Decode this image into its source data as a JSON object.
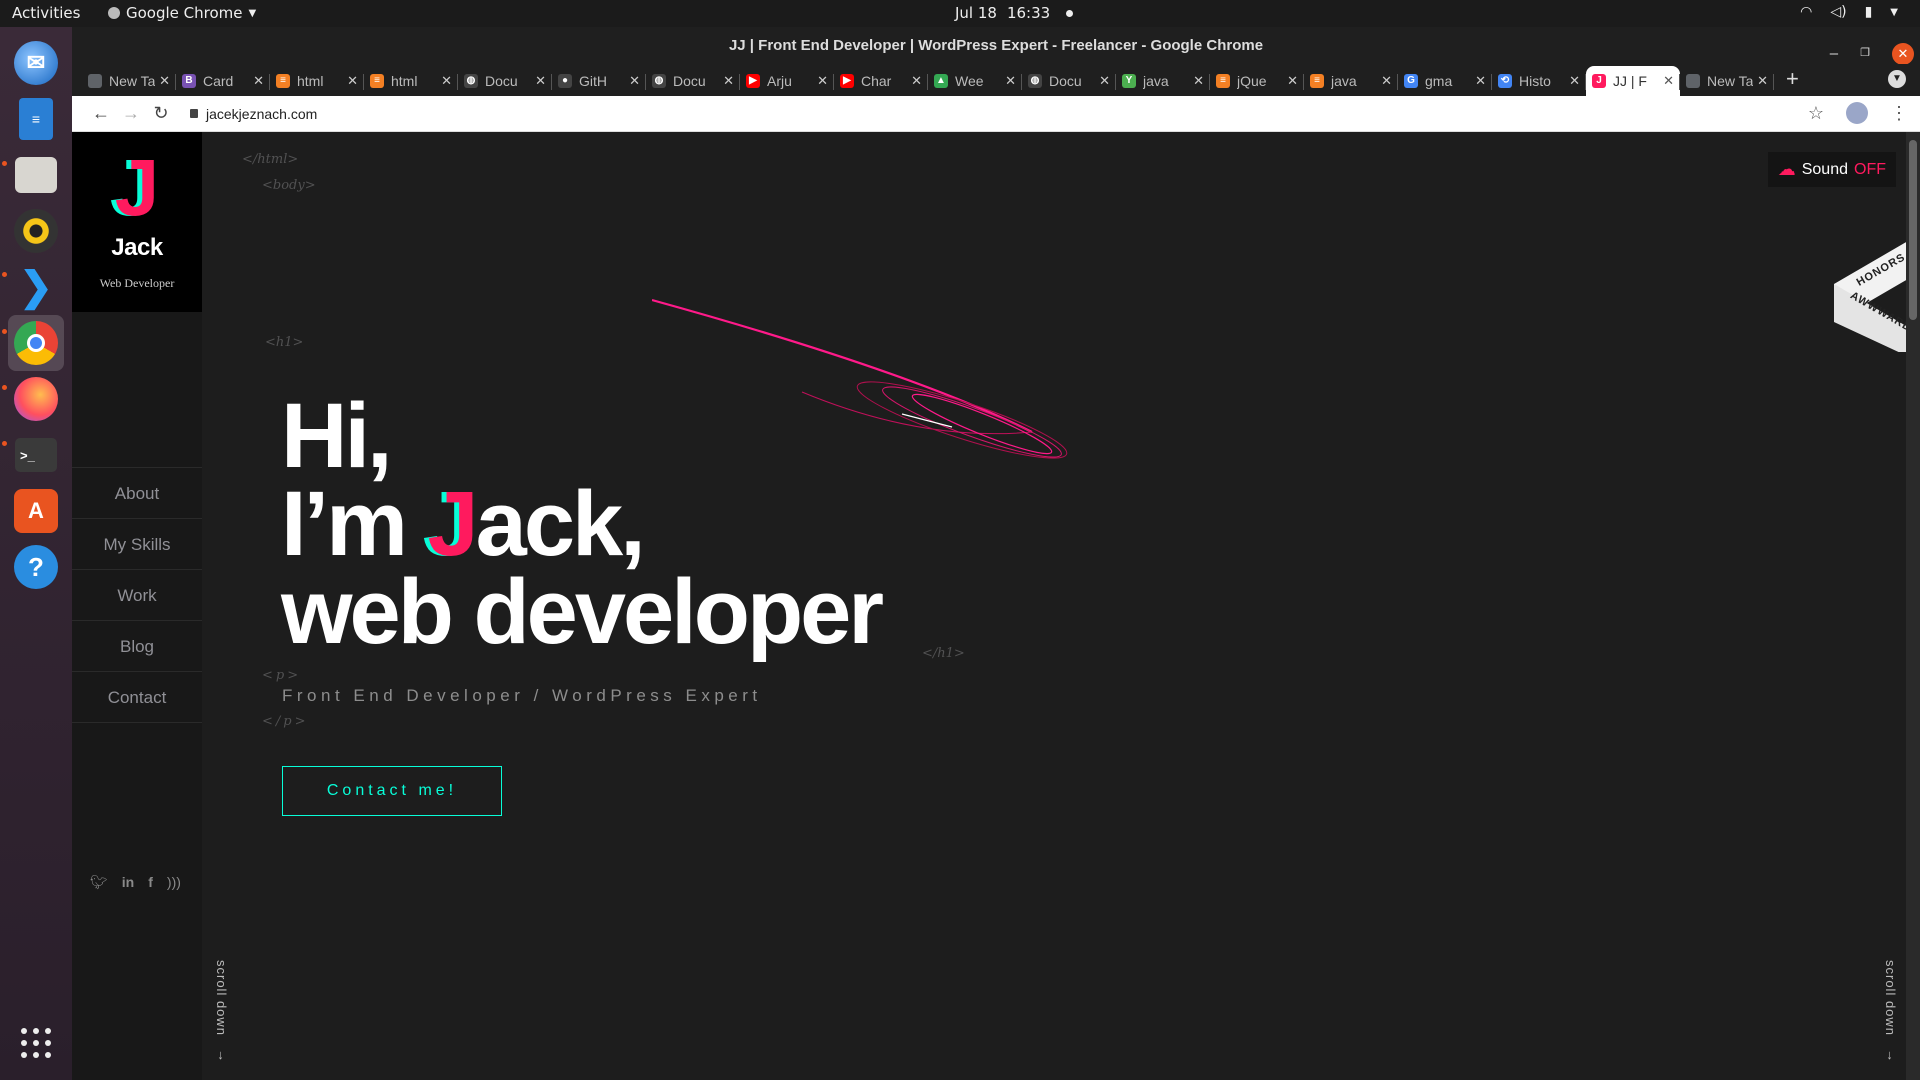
{
  "topbar": {
    "activities": "Activities",
    "app_name": "Google Chrome",
    "date": "Jul 18",
    "time": "16:33"
  },
  "dock": {
    "items": [
      "thunderbird-icon",
      "libreoffice-writer-icon",
      "files-icon",
      "rhythmbox-icon",
      "vscode-icon",
      "chrome-icon",
      "firefox-icon",
      "terminal-icon",
      "software-center-icon",
      "help-icon"
    ],
    "show_apps": "show-applications-icon"
  },
  "window": {
    "title": "JJ | Front End Developer | WordPress Expert - Freelancer - Google Chrome"
  },
  "tabs": [
    {
      "label": "New Tab",
      "color": "#5f6368",
      "glyph": ""
    },
    {
      "label": "Card",
      "color": "#7952b3",
      "glyph": "B"
    },
    {
      "label": "html",
      "color": "#f48024",
      "glyph": "≡"
    },
    {
      "label": "html",
      "color": "#f48024",
      "glyph": "≡"
    },
    {
      "label": "Docu",
      "color": "#444",
      "glyph": "◍"
    },
    {
      "label": "GitH",
      "color": "#444",
      "glyph": "●"
    },
    {
      "label": "Docu",
      "color": "#444",
      "glyph": "◍"
    },
    {
      "label": "Arju",
      "color": "#ff0000",
      "glyph": "▶"
    },
    {
      "label": "Char",
      "color": "#ff0000",
      "glyph": "▶"
    },
    {
      "label": "Wee",
      "color": "#34a853",
      "glyph": "▲"
    },
    {
      "label": "Docu",
      "color": "#444",
      "glyph": "◍"
    },
    {
      "label": "java",
      "color": "#4caf50",
      "glyph": "Y"
    },
    {
      "label": "jQue",
      "color": "#f48024",
      "glyph": "≡"
    },
    {
      "label": "java",
      "color": "#f48024",
      "glyph": "≡"
    },
    {
      "label": "gma",
      "color": "#4285f4",
      "glyph": "G"
    },
    {
      "label": "Histo",
      "color": "#4285f4",
      "glyph": "⟲"
    },
    {
      "label": "JJ | F",
      "color": "#ff1a5e",
      "glyph": "J",
      "active": true
    },
    {
      "label": "New Tab",
      "color": "#5f6368",
      "glyph": ""
    }
  ],
  "omnibar": {
    "url": "jacekjeznach.com"
  },
  "site": {
    "logo_letter": "J",
    "logo_name": "Jack",
    "logo_role": "Web Developer",
    "menu": [
      "About",
      "My Skills",
      "Work",
      "Blog",
      "Contact"
    ],
    "social": [
      "twitter-icon",
      "linkedin-icon",
      "facebook-icon",
      "rss-icon"
    ],
    "tags": {
      "html_close": "</html>",
      "body": "<body>",
      "h1_open": "<h1>",
      "h1_close": "</h1>",
      "p_open": "<p>",
      "p_close": "</p>"
    },
    "hero": {
      "line1": "Hi,",
      "line2_pre": "I’m ",
      "line2_j": "J",
      "line2_post": "ack,",
      "line3": "web developer"
    },
    "subtitle": "Front End Developer / WordPress Expert",
    "cta": "Contact me!",
    "sound_label": "Sound",
    "sound_state": "OFF",
    "award_top": "HONORS",
    "award_bottom": "AWWWARDS",
    "scroll_down": "scroll down"
  },
  "colors": {
    "accent_pink": "#ff1a5e",
    "accent_cyan": "#08fdd8",
    "page_bg": "#1d1d1d"
  }
}
